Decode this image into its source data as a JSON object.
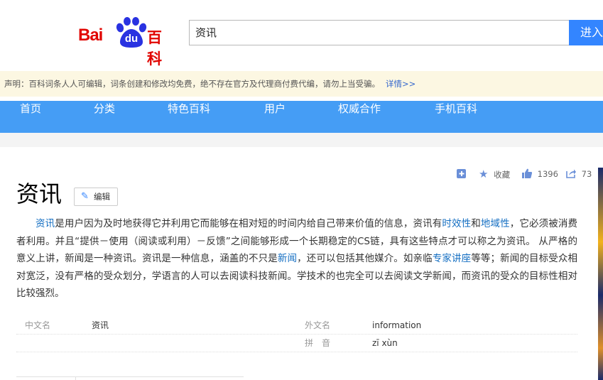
{
  "header": {
    "logo": {
      "bai": "Bai",
      "du": "du",
      "baike": "百科"
    },
    "search_value": "资讯",
    "search_button": "进入"
  },
  "notice": {
    "text": "声明：百科词条人人可编辑，词条创建和修改均免费，绝不存在官方及代理商付费代编，请勿上当受骗。",
    "link": "详情>>"
  },
  "nav": [
    "首页",
    "分类",
    "特色百科",
    "用户",
    "权威合作",
    "手机百科"
  ],
  "toolbar": {
    "collect_label": "收藏",
    "like_count": "1396",
    "share_count": "73"
  },
  "entry": {
    "title": "资讯",
    "edit_label": "编辑"
  },
  "paragraph": {
    "l1": "资讯",
    "t1": "是用户因为及时地获得它并利用它而能够在相对短的时间内给自己带来价值的信息，资讯有",
    "l2": "时效性",
    "t2": "和",
    "l3": "地域性",
    "t3": "，它必须被消费者利用。并且“提供－使用（阅读或利用）－反馈”之间能够形成一个长期稳定的CS链，具有这些特点才可以称之为资讯。 从严格的意义上讲，新闻是一种资讯。资讯是一种信息，涵盖的不只是",
    "l4": "新闻",
    "t4": "，还可以包括其他媒介。如亲临",
    "l5": "专家讲座",
    "t5": "等等；新闻的目标受众相对宽泛，没有严格的受众划分，学语言的人可以去阅读科技新闻。学技术的也完全可以去阅读文学新闻，而资讯的受众的目标性相对比较强烈。"
  },
  "basic_info": {
    "row1": {
      "name1": "中文名",
      "value1": "资讯",
      "name2": "外文名",
      "value2": "information"
    },
    "row2": {
      "name2": "拼　音",
      "value2": "zī xùn"
    }
  },
  "colors": {
    "brand_red": "#e10602",
    "nav_blue": "#459df5",
    "search_blue": "#3385ff",
    "link_blue": "#136ec2",
    "notice_bg": "#fcf7e2"
  }
}
